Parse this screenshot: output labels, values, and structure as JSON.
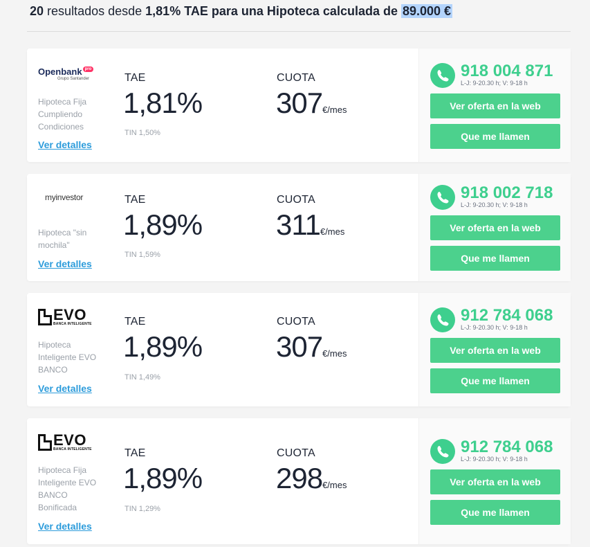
{
  "header": {
    "count": "20",
    "text1": "resultados desde",
    "rate": "1,81% TAE",
    "text2": "para una Hipoteca calculada de",
    "amount": "89.000 €"
  },
  "offers": [
    {
      "bank": "Openbank",
      "logo_badge": "pro",
      "logo_sub": "Grupo Santander",
      "product": "Hipoteca Fija Cumpliendo Condiciones",
      "details_label": "Ver detalles",
      "tae_label": "TAE",
      "tae": "1,81%",
      "tin": "TIN 1,50%",
      "cuota_label": "CUOTA",
      "cuota": "307",
      "cuota_unit": "€/mes",
      "phone": "918 004 871",
      "hours": "L-J: 9-20.30 h; V: 9-18 h",
      "web_button": "Ver oferta en la web",
      "call_button": "Que me llamen"
    },
    {
      "bank": "myinvestor",
      "product": "Hipoteca \"sin mochila\"",
      "details_label": "Ver detalles",
      "tae_label": "TAE",
      "tae": "1,89%",
      "tin": "TIN 1,59%",
      "cuota_label": "CUOTA",
      "cuota": "311",
      "cuota_unit": "€/mes",
      "phone": "918 002 718",
      "hours": "L-J: 9-20.30 h; V: 9-18 h",
      "web_button": "Ver oferta en la web",
      "call_button": "Que me llamen"
    },
    {
      "bank": "EVO",
      "logo_sub": "BANCA INTELIGENTE",
      "product": "Hipoteca Inteligente EVO BANCO",
      "details_label": "Ver detalles",
      "tae_label": "TAE",
      "tae": "1,89%",
      "tin": "TIN 1,49%",
      "cuota_label": "CUOTA",
      "cuota": "307",
      "cuota_unit": "€/mes",
      "phone": "912 784 068",
      "hours": "L-J: 9-20.30 h; V: 9-18 h",
      "web_button": "Ver oferta en la web",
      "call_button": "Que me llamen"
    },
    {
      "bank": "EVO",
      "logo_sub": "BANCA INTELIGENTE",
      "product": "Hipoteca Fija Inteligente EVO BANCO Bonificada",
      "details_label": "Ver detalles",
      "tae_label": "TAE",
      "tae": "1,89%",
      "tin": "TIN 1,29%",
      "cuota_label": "CUOTA",
      "cuota": "298",
      "cuota_unit": "€/mes",
      "phone": "912 784 068",
      "hours": "L-J: 9-20.30 h; V: 9-18 h",
      "web_button": "Ver oferta en la web",
      "call_button": "Que me llamen"
    }
  ],
  "colors": {
    "accent_green": "#4cd18d",
    "phone_green": "#3ecf8e",
    "link_blue": "#2d9cdb",
    "text_dark": "#1d2433"
  }
}
